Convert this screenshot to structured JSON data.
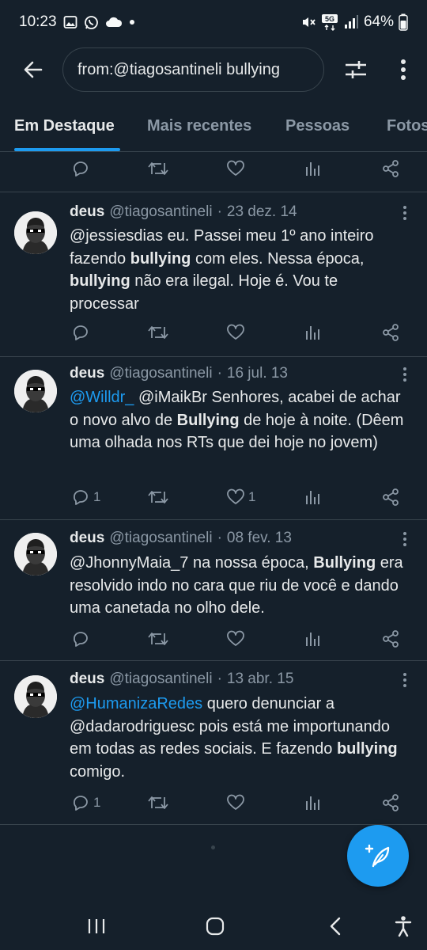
{
  "status_bar": {
    "time": "10:23",
    "battery": "64%",
    "network": "5G",
    "left_icons": [
      "gallery-icon",
      "whatsapp-icon",
      "cloud-icon",
      "dot-icon"
    ],
    "right_icons": [
      "mute-icon",
      "5g-icon",
      "signal-icon",
      "battery-icon"
    ]
  },
  "search": {
    "query": "from:@tiagosantineli bullying"
  },
  "tabs": [
    {
      "label": "Em Destaque",
      "active": true
    },
    {
      "label": "Mais recentes",
      "active": false
    },
    {
      "label": "Pessoas",
      "active": false
    },
    {
      "label": "Fotos",
      "active": false
    }
  ],
  "tweets": [
    {
      "name": "deus",
      "handle": "@tiagosantineli",
      "separator": "·",
      "date": "23 dez. 14",
      "text_parts": [
        {
          "t": "@jessiesdias eu. Passei meu 1º ano inteiro fazendo ",
          "s": "normal"
        },
        {
          "t": "bullying",
          "s": "bold"
        },
        {
          "t": " com eles. Nessa época, ",
          "s": "normal"
        },
        {
          "t": "bullying",
          "s": "bold"
        },
        {
          "t": " não era ilegal. Hoje é. Vou te processar",
          "s": "normal"
        }
      ],
      "replies": "",
      "likes": ""
    },
    {
      "name": "deus",
      "handle": "@tiagosantineli",
      "separator": "·",
      "date": "16 jul. 13",
      "text_parts": [
        {
          "t": "@Willdr_",
          "s": "link"
        },
        {
          "t": " @iMaikBr Senhores, acabei de achar o novo alvo de ",
          "s": "normal"
        },
        {
          "t": "Bullying",
          "s": "bold"
        },
        {
          "t": " de hoje à noite. (Dêem uma olhada nos RTs que dei hoje no jovem)",
          "s": "normal"
        }
      ],
      "replies": "1",
      "likes": "1"
    },
    {
      "name": "deus",
      "handle": "@tiagosantineli",
      "separator": "·",
      "date": "08 fev. 13",
      "text_parts": [
        {
          "t": "@JhonnyMaia_7 na nossa época, ",
          "s": "normal"
        },
        {
          "t": "Bullying",
          "s": "bold"
        },
        {
          "t": " era resolvido indo no cara que riu de você e dando uma canetada no olho dele.",
          "s": "normal"
        }
      ],
      "replies": "",
      "likes": ""
    },
    {
      "name": "deus",
      "handle": "@tiagosantineli",
      "separator": "·",
      "date": "13 abr. 15",
      "text_parts": [
        {
          "t": "@HumanizaRedes",
          "s": "link"
        },
        {
          "t": " quero denunciar a @dadarodriguesc pois  está me importunando em todas as redes sociais. E fazendo ",
          "s": "normal"
        },
        {
          "t": "bullying",
          "s": "bold"
        },
        {
          "t": " comigo.",
          "s": "normal"
        }
      ],
      "replies": "1",
      "likes": ""
    }
  ],
  "colors": {
    "background": "#15202b",
    "accent": "#1d9bf0",
    "text": "#e7e9ea",
    "muted": "#8b98a5",
    "divider": "#38444d"
  },
  "icons": {
    "back": "arrow-left-icon",
    "filter": "sliders-icon",
    "more": "more-vertical-icon",
    "reply": "reply-icon",
    "retweet": "retweet-icon",
    "like": "heart-icon",
    "views": "views-icon",
    "share": "share-icon",
    "compose": "compose-icon"
  }
}
